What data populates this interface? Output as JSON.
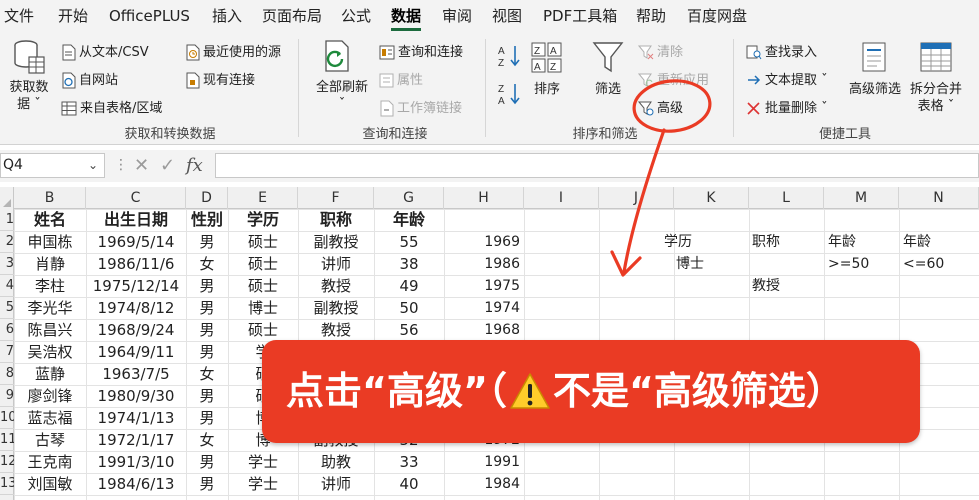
{
  "menu": {
    "items": [
      "文件",
      "开始",
      "OfficePLUS",
      "插入",
      "页面布局",
      "公式",
      "数据",
      "审阅",
      "视图",
      "PDF工具箱",
      "帮助",
      "百度网盘"
    ],
    "active": "数据"
  },
  "ribbon": {
    "get_data_label_1": "获取数",
    "get_data_label_2": "据 ˇ",
    "from_text_csv": "从文本/CSV",
    "from_web": "自网站",
    "from_table": "来自表格/区域",
    "recent_sources": "最近使用的源",
    "existing_connections": "现有连接",
    "group_get_transform": "获取和转换数据",
    "refresh_all_1": "全部刷新",
    "refresh_all_2": "ˇ",
    "queries_connections": "查询和连接",
    "properties": "属性",
    "edit_links": "工作簿链接",
    "group_queries": "查询和连接",
    "sort_az": "A→Z",
    "sort_za": "Z→A",
    "sort": "排序",
    "filter": "筛选",
    "clear": "清除",
    "reapply": "重新应用",
    "advanced": "高级",
    "group_sort_filter": "排序和筛选",
    "find_entry": "查找录入",
    "text_extract": "文本提取 ˇ",
    "batch_delete": "批量删除 ˇ",
    "advanced_filter": "高级筛选",
    "split_merge_1": "拆分合并",
    "split_merge_2": "表格 ˇ",
    "group_quick_tools": "便捷工具"
  },
  "formula_bar": {
    "name_box": "Q4",
    "cancel": "✕",
    "confirm": "✓",
    "fx": "fx",
    "value": ""
  },
  "sheet": {
    "columns": [
      "B",
      "C",
      "D",
      "E",
      "F",
      "G",
      "H",
      "I",
      "J",
      "K",
      "L",
      "M",
      "N"
    ],
    "row_numbers": [
      "1",
      "2",
      "3",
      "4",
      "5",
      "6",
      "7",
      "8",
      "9",
      "10",
      "11",
      "12",
      "13"
    ],
    "headers": [
      "姓名",
      "出生日期",
      "性别",
      "学历",
      "职称",
      "年龄"
    ],
    "rows": [
      [
        "申国栋",
        "1969/5/14",
        "男",
        "硕士",
        "副教授",
        "55",
        "1969"
      ],
      [
        "肖静",
        "1986/11/6",
        "女",
        "硕士",
        "讲师",
        "38",
        "1986"
      ],
      [
        "李柱",
        "1975/12/14",
        "男",
        "硕士",
        "教授",
        "49",
        "1975"
      ],
      [
        "李光华",
        "1974/8/12",
        "男",
        "博士",
        "副教授",
        "50",
        "1974"
      ],
      [
        "陈昌兴",
        "1968/9/24",
        "男",
        "硕士",
        "教授",
        "56",
        "1968"
      ],
      [
        "吴浩权",
        "1964/9/11",
        "男",
        "学",
        "",
        "",
        ""
      ],
      [
        "蓝静",
        "1963/7/5",
        "女",
        "硕",
        "",
        "",
        ""
      ],
      [
        "廖剑锋",
        "1980/9/30",
        "男",
        "硕",
        "",
        "",
        ""
      ],
      [
        "蓝志福",
        "1974/1/13",
        "男",
        "博",
        "",
        "",
        ""
      ],
      [
        "古琴",
        "1972/1/17",
        "女",
        "博",
        "副教授",
        "52",
        "1972"
      ],
      [
        "王克南",
        "1991/3/10",
        "男",
        "学士",
        "助教",
        "33",
        "1991"
      ],
      [
        "刘国敏",
        "1984/6/13",
        "男",
        "学士",
        "讲师",
        "40",
        "1984"
      ]
    ],
    "criteria": {
      "row1": [
        "学历",
        "职称",
        "年龄",
        "年龄"
      ],
      "row2": [
        "博士",
        "",
        ">=50",
        "<=60"
      ],
      "row3": [
        "",
        "教授",
        "",
        ""
      ]
    }
  },
  "annotation": {
    "text_before": "点击“高级”（",
    "text_after": "不是“高级筛选）",
    "color": "#ea3b24"
  }
}
